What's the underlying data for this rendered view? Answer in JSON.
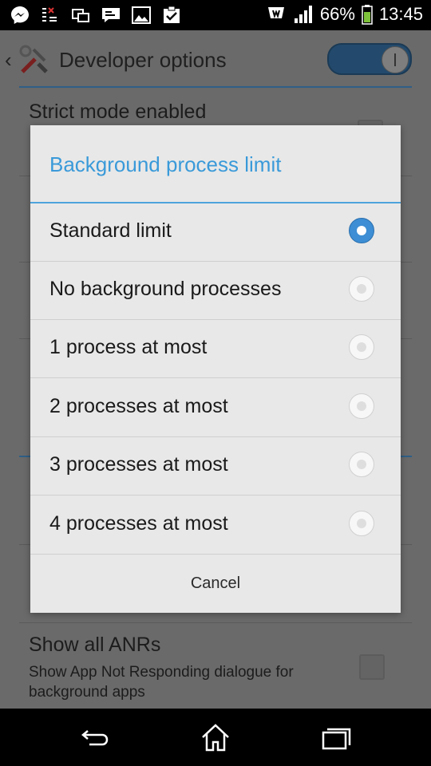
{
  "status_bar": {
    "battery_percent": "66%",
    "time": "13:45",
    "left_icons": [
      "messenger-icon",
      "notification-icon",
      "screen-mirror-icon",
      "chat-icon",
      "gallery-icon",
      "clipboard-icon"
    ],
    "right_icons": [
      "alarm-icon",
      "signal-icon",
      "battery-icon"
    ]
  },
  "action_bar": {
    "title": "Developer options",
    "switch_on": true
  },
  "background_list": {
    "strict_mode_title": "Strict mode enabled",
    "anr_title": "Show all ANRs",
    "anr_summary": "Show App Not Responding dialogue for background apps"
  },
  "dialog": {
    "title": "Background process limit",
    "options": [
      {
        "label": "Standard limit",
        "selected": true
      },
      {
        "label": "No background processes",
        "selected": false
      },
      {
        "label": "1 process at most",
        "selected": false
      },
      {
        "label": "2 processes at most",
        "selected": false
      },
      {
        "label": "3 processes at most",
        "selected": false
      },
      {
        "label": "4 processes at most",
        "selected": false
      }
    ],
    "cancel_label": "Cancel"
  },
  "nav_bar": {
    "buttons": [
      "back-icon",
      "home-icon",
      "recents-icon"
    ]
  },
  "colors": {
    "accent": "#3a9ad9",
    "radio_selected": "#3d8ed4",
    "dialog_bg": "#e8e8e8",
    "scrim_bg": "#6a6a6a"
  }
}
